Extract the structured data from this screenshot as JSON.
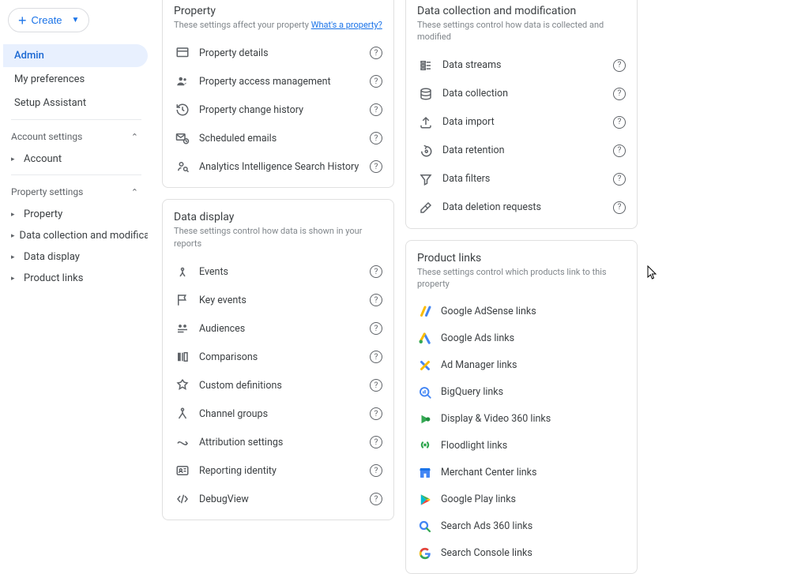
{
  "sidebar": {
    "create_label": "Create",
    "nav": {
      "admin": "Admin",
      "prefs": "My preferences",
      "setup": "Setup Assistant"
    },
    "account_settings_header": "Account settings",
    "account": "Account",
    "property_settings_header": "Property settings",
    "property": "Property",
    "data_collection": "Data collection and modifica...",
    "data_display": "Data display",
    "product_links": "Product links"
  },
  "property_card": {
    "title": "Property",
    "subtitle_prefix": "These settings affect your property ",
    "subtitle_link": "What's a property?",
    "items": {
      "details": "Property details",
      "access": "Property access management",
      "history": "Property change history",
      "emails": "Scheduled emails",
      "search": "Analytics Intelligence Search History"
    }
  },
  "display_card": {
    "title": "Data display",
    "subtitle": "These settings control how data is shown in your reports",
    "items": {
      "events": "Events",
      "key_events": "Key events",
      "audiences": "Audiences",
      "comparisons": "Comparisons",
      "custom": "Custom definitions",
      "channel": "Channel groups",
      "attribution": "Attribution settings",
      "reporting": "Reporting identity",
      "debug": "DebugView"
    }
  },
  "collection_card": {
    "title": "Data collection and modification",
    "subtitle": "These settings control how data is collected and modified",
    "items": {
      "streams": "Data streams",
      "collection": "Data collection",
      "import": "Data import",
      "retention": "Data retention",
      "filters": "Data filters",
      "deletion": "Data deletion requests"
    }
  },
  "products_card": {
    "title": "Product links",
    "subtitle": "These settings control which products link to this property",
    "items": {
      "adsense": "Google AdSense links",
      "ads": "Google Ads links",
      "admanager": "Ad Manager links",
      "bigquery": "BigQuery links",
      "dv360": "Display & Video 360 links",
      "floodlight": "Floodlight links",
      "merchant": "Merchant Center links",
      "play": "Google Play links",
      "sa360": "Search Ads 360 links",
      "console": "Search Console links"
    }
  }
}
